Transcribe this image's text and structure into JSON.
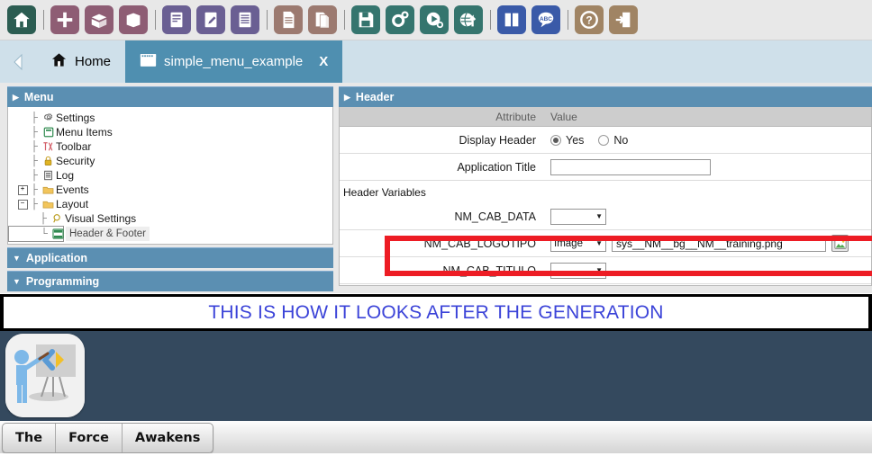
{
  "toolbar": {
    "groups": [
      {
        "items": [
          {
            "name": "home-icon",
            "label": "Home",
            "color": "#2c5d52"
          }
        ]
      },
      {
        "items": [
          {
            "name": "new-project-icon",
            "label": "New Project",
            "color": "#8e5d74"
          },
          {
            "name": "open-box-icon",
            "label": "Open Project",
            "color": "#8e5d74"
          },
          {
            "name": "box-icon",
            "label": "Project",
            "color": "#8e5d74"
          }
        ]
      },
      {
        "items": [
          {
            "name": "new-application-icon",
            "label": "New Application",
            "color": "#6a5f93"
          },
          {
            "name": "edit-application-icon",
            "label": "Edit Application",
            "color": "#6a5f93"
          },
          {
            "name": "list-applications-icon",
            "label": "List Applications",
            "color": "#6a5f93"
          }
        ]
      },
      {
        "items": [
          {
            "name": "page-icon",
            "label": "New Page",
            "color": "#9c7a70"
          },
          {
            "name": "pages-icon",
            "label": "Pages",
            "color": "#9c7a70"
          }
        ]
      },
      {
        "items": [
          {
            "name": "save-icon",
            "label": "Save",
            "color": "#35756e"
          },
          {
            "name": "generate-source-icon",
            "label": "Generate Source",
            "color": "#35756e"
          },
          {
            "name": "run-icon",
            "label": "Run",
            "color": "#35756e"
          },
          {
            "name": "publish-icon",
            "label": "Publish",
            "color": "#35756e"
          }
        ]
      },
      {
        "items": [
          {
            "name": "manual-icon",
            "label": "Manual",
            "color": "#3a5aa8"
          },
          {
            "name": "dictionary-icon",
            "label": "Dictionary",
            "color": "#3a5aa8"
          }
        ]
      },
      {
        "items": [
          {
            "name": "help-icon",
            "label": "Help",
            "color": "#a08464"
          },
          {
            "name": "exit-icon",
            "label": "Exit",
            "color": "#a08464"
          }
        ]
      }
    ]
  },
  "tabbar": {
    "back_icon": "back-arrow-icon",
    "home_tab": {
      "label": "Home",
      "icon": "home-icon"
    },
    "active_tab": {
      "label": "simple_menu_example",
      "icon": "window-icon",
      "close": "X"
    }
  },
  "sidebar": {
    "panels": [
      {
        "title": "Menu",
        "caret": "▶",
        "expanded": true
      },
      {
        "title": "Application",
        "caret": "▼",
        "expanded": false
      },
      {
        "title": "Programming",
        "caret": "▼",
        "expanded": false
      }
    ],
    "tree": [
      {
        "label": "Settings",
        "icon": "gear-icon",
        "indent": 0,
        "expander": "",
        "selected": false
      },
      {
        "label": "Menu Items",
        "icon": "menu-items-icon",
        "indent": 0,
        "expander": "",
        "selected": false
      },
      {
        "label": "Toolbar",
        "icon": "toolbar-icon",
        "indent": 0,
        "expander": "",
        "selected": false
      },
      {
        "label": "Security",
        "icon": "lock-icon",
        "indent": 0,
        "expander": "",
        "selected": false
      },
      {
        "label": "Log",
        "icon": "log-icon",
        "indent": 0,
        "expander": "",
        "selected": false
      },
      {
        "label": "Events",
        "icon": "folder-icon",
        "indent": 0,
        "expander": "+",
        "selected": false
      },
      {
        "label": "Layout",
        "icon": "folder-icon",
        "indent": 0,
        "expander": "−",
        "selected": false
      },
      {
        "label": "Visual Settings",
        "icon": "magnifier-icon",
        "indent": 1,
        "expander": "",
        "selected": false
      },
      {
        "label": "Header & Footer",
        "icon": "header-footer-icon",
        "indent": 1,
        "expander": "",
        "selected": true
      }
    ]
  },
  "header_panel": {
    "title": "Header",
    "caret": "▶",
    "columns": {
      "attribute": "Attribute",
      "value": "Value"
    },
    "display_header": {
      "label": "Display Header",
      "selected": "Yes",
      "options": [
        {
          "label": "Yes",
          "checked": true
        },
        {
          "label": "No",
          "checked": false
        }
      ]
    },
    "application_title": {
      "label": "Application Title",
      "value": "",
      "placeholder": ""
    },
    "header_variables_label": "Header Variables",
    "variables": [
      {
        "name": "NM_CAB_DATA",
        "type": "",
        "value": "",
        "has_image_button": false
      },
      {
        "name": "NM_CAB_LOGOTIPO",
        "type": "Image",
        "value": "sys__NM__bg__NM__training.png",
        "has_image_button": true
      },
      {
        "name": "NM_CAB_TITULO",
        "type": "",
        "value": "",
        "has_image_button": false
      }
    ],
    "highlight_color": "#ed1c24"
  },
  "banner": {
    "text": "THIS IS HOW IT LOOKS AFTER THE GENERATION",
    "text_color": "#3b43d8"
  },
  "generated_app": {
    "header_background": "#34495e",
    "logo_icon": "training-presentation-logo",
    "menu_items": [
      "The",
      "Force",
      "Awakens"
    ]
  }
}
